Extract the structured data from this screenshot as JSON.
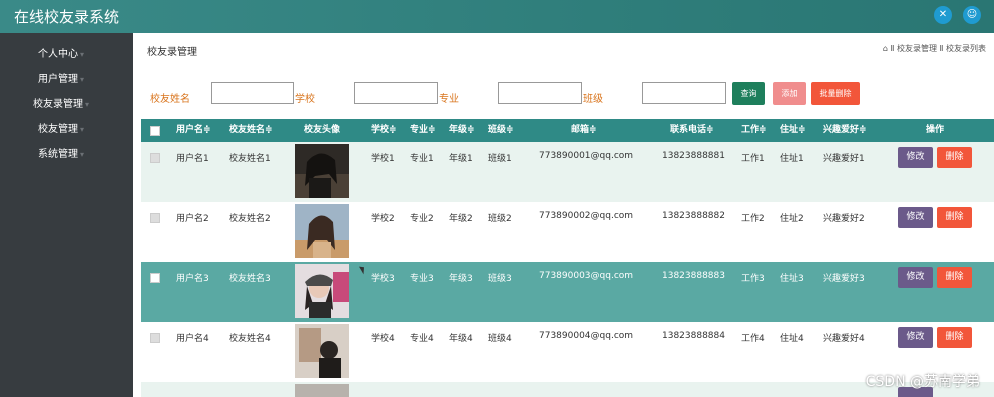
{
  "app": {
    "title": "在线校友录系统"
  },
  "header": {
    "icons": [
      "expand-icon",
      "user-icon"
    ]
  },
  "sidebar": {
    "items": [
      {
        "label": "个人中心"
      },
      {
        "label": "用户管理"
      },
      {
        "label": "校友录管理"
      },
      {
        "label": "校友管理"
      },
      {
        "label": "系统管理"
      }
    ]
  },
  "page": {
    "title": "校友录管理",
    "breadcrumb": {
      "home": "⌂",
      "sep": "Ⅱ",
      "item1": "校友录管理",
      "item2": "校友录列表"
    }
  },
  "search": {
    "name_label": "校友姓名",
    "school_label": "学校",
    "major_label": "专业",
    "class_label": "班级",
    "query_button": "查询",
    "add_button": "添加",
    "batch_delete_button": "批量删除"
  },
  "table": {
    "headers": {
      "username": "用户名≑",
      "alumni_name": "校友姓名≑",
      "avatar": "校友头像",
      "school": "学校≑",
      "major": "专业≑",
      "grade": "年级≑",
      "class": "班级≑",
      "email": "邮箱≑",
      "phone": "联系电话≑",
      "job": "工作≑",
      "address": "住址≑",
      "hobby": "兴趣爱好≑",
      "actions": "操作"
    },
    "rows": [
      {
        "username": "用户名1",
        "alumni_name": "校友姓名1",
        "school": "学校1",
        "major": "专业1",
        "grade": "年级1",
        "class": "班级1",
        "email": "773890001@qq.com",
        "phone": "13823888881",
        "job": "工作1",
        "address": "住址1",
        "hobby": "兴趣爱好1",
        "edit": "修改",
        "delete": "删除"
      },
      {
        "username": "用户名2",
        "alumni_name": "校友姓名2",
        "school": "学校2",
        "major": "专业2",
        "grade": "年级2",
        "class": "班级2",
        "email": "773890002@qq.com",
        "phone": "13823888882",
        "job": "工作2",
        "address": "住址2",
        "hobby": "兴趣爱好2",
        "edit": "修改",
        "delete": "删除"
      },
      {
        "username": "用户名3",
        "alumni_name": "校友姓名3",
        "school": "学校3",
        "major": "专业3",
        "grade": "年级3",
        "class": "班级3",
        "email": "773890003@qq.com",
        "phone": "13823888883",
        "job": "工作3",
        "address": "住址3",
        "hobby": "兴趣爱好3",
        "edit": "修改",
        "delete": "删除"
      },
      {
        "username": "用户名4",
        "alumni_name": "校友姓名4",
        "school": "学校4",
        "major": "专业4",
        "grade": "年级4",
        "class": "班级4",
        "email": "773890004@qq.com",
        "phone": "13823888884",
        "job": "工作4",
        "address": "住址4",
        "hobby": "兴趣爱好4",
        "edit": "修改",
        "delete": "删除"
      }
    ]
  },
  "watermark": "CSDN @苏南学弟",
  "colors": {
    "header": "#2f7e7b",
    "sidebar": "#373c40",
    "table_header": "#2f8a86",
    "row_highlight": "#5aa9a3",
    "row_alt": "#e9f3ef",
    "query": "#1e7f5c",
    "add": "#f08d8d",
    "batch_delete": "#f2563a",
    "edit": "#6b5a8a",
    "delete": "#f2563a",
    "label": "#d9751e"
  }
}
